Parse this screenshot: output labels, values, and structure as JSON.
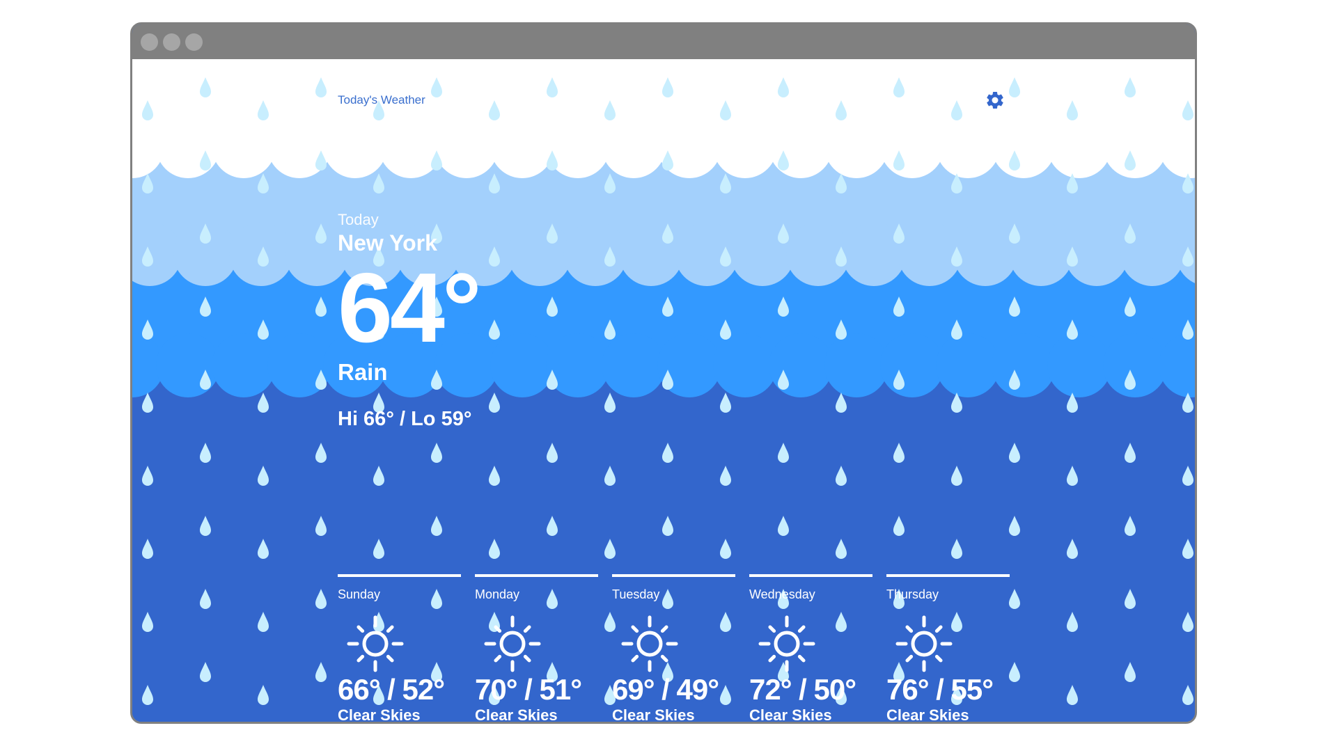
{
  "app": {
    "title": "Today's Weather"
  },
  "icons": {
    "settings": "gear-icon",
    "forecast": "sun-icon",
    "drop": "raindrop-icon"
  },
  "colors": {
    "accent": "#3366cc",
    "sky_white": "#ffffff",
    "sky_light": "#a3d0fc",
    "sky_mid": "#3399ff",
    "sky_dark": "#3366cc",
    "drop": "#c8eefe",
    "title_text": "#3a6fce"
  },
  "current": {
    "label": "Today",
    "city": "New York",
    "temperature": "64°",
    "condition": "Rain",
    "hi_lo": "Hi 66° / Lo 59°"
  },
  "forecast": [
    {
      "day": "Sunday",
      "temps": "66° / 52°",
      "condition": "Clear Skies"
    },
    {
      "day": "Monday",
      "temps": "70° / 51°",
      "condition": "Clear Skies"
    },
    {
      "day": "Tuesday",
      "temps": "69° / 49°",
      "condition": "Clear Skies"
    },
    {
      "day": "Wednesday",
      "temps": "72° / 50°",
      "condition": "Clear Skies"
    },
    {
      "day": "Thursday",
      "temps": "76° / 55°",
      "condition": "Clear Skies"
    }
  ]
}
